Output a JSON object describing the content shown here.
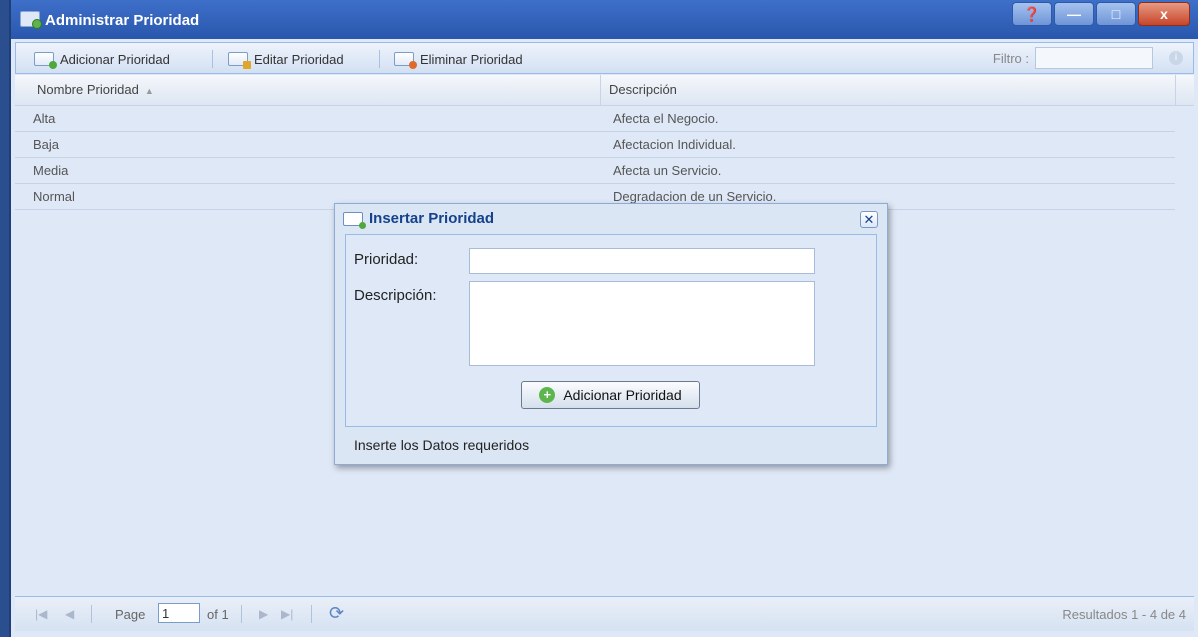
{
  "window": {
    "title": "Administrar Prioridad",
    "controls": {
      "help": "❓",
      "minimize": "—",
      "maximize": "□",
      "close": "x"
    }
  },
  "toolbar": {
    "add_label": "Adicionar Prioridad",
    "edit_label": "Editar Prioridad",
    "delete_label": "Eliminar Prioridad",
    "filter_label": "Filtro :",
    "filter_value": ""
  },
  "grid": {
    "columns": [
      "Nombre Prioridad",
      "Descripción"
    ],
    "rows": [
      [
        "Alta",
        "Afecta el Negocio."
      ],
      [
        "Baja",
        "Afectacion Individual."
      ],
      [
        "Media",
        "Afecta un Servicio."
      ],
      [
        "Normal",
        "Degradacion de un Servicio."
      ]
    ]
  },
  "paging": {
    "page_label": "Page",
    "page_value": "1",
    "of_label": "of 1",
    "results": "Resultados 1 - 4 de 4"
  },
  "dialog": {
    "title": "Insertar Prioridad",
    "priority_label": "Prioridad:",
    "priority_value": "",
    "description_label": "Descripción:",
    "description_value": "",
    "submit_label": "Adicionar Prioridad",
    "status": "Inserte los Datos requeridos"
  },
  "colors": {
    "accent": "#15428b",
    "titlebar": "#2957ad",
    "panel": "#dfe8f6",
    "border": "#99bbe8"
  }
}
